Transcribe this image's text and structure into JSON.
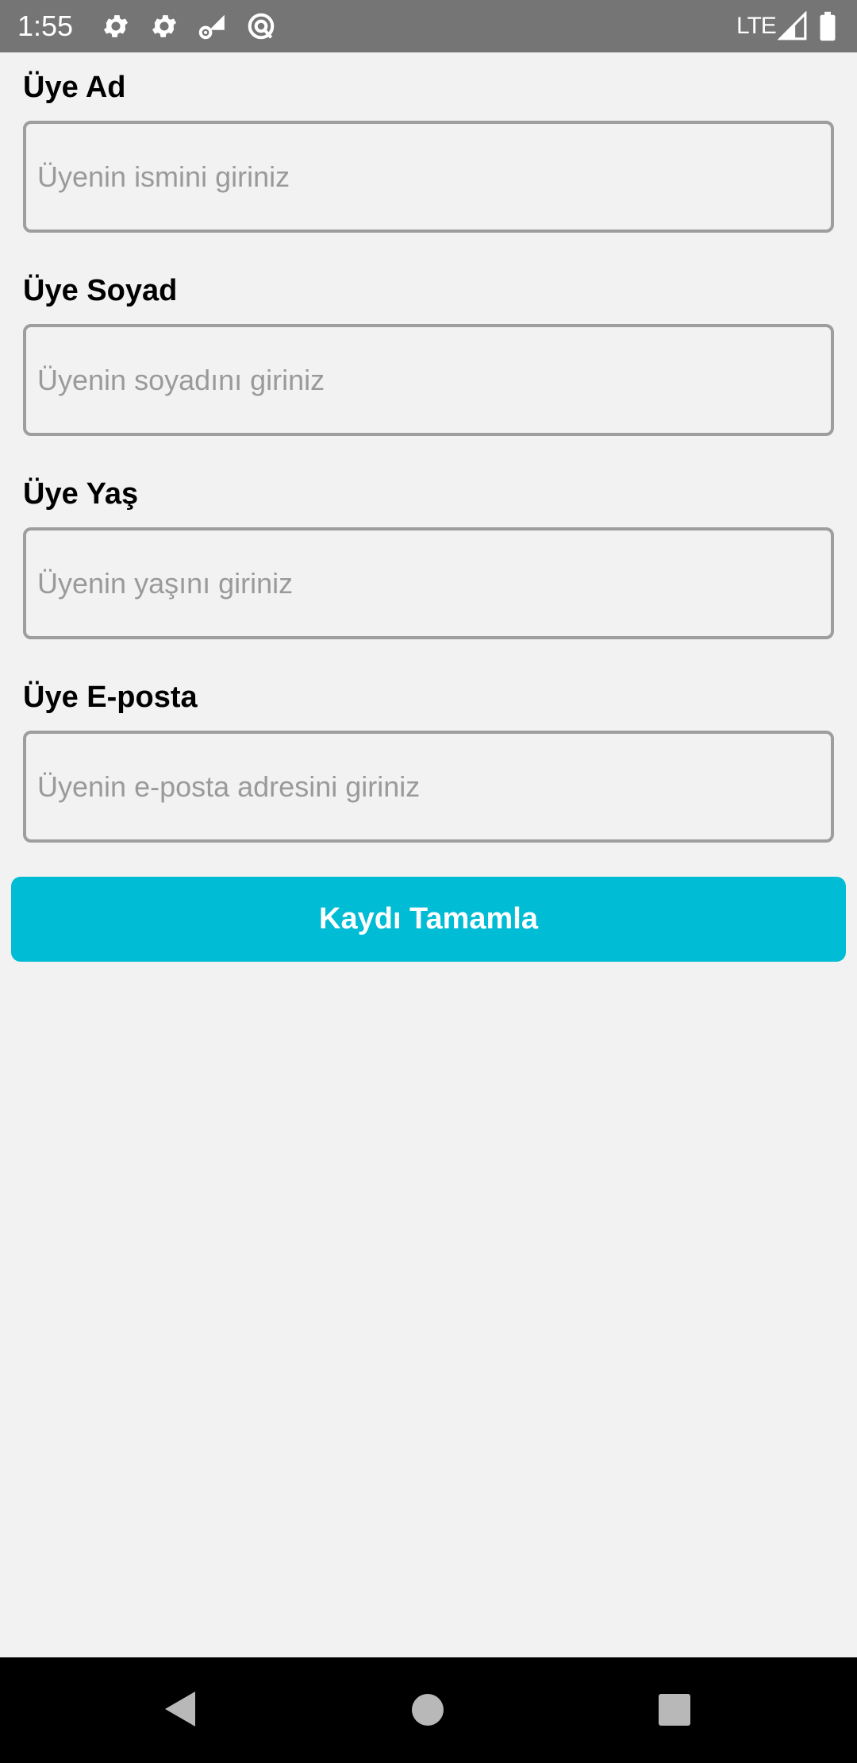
{
  "status_bar": {
    "time": "1:55",
    "network": "LTE",
    "icons": [
      "settings-icon",
      "settings-icon",
      "network-settings-icon",
      "data-saver-icon",
      "signal-icon",
      "battery-icon"
    ]
  },
  "form": {
    "fields": [
      {
        "label": "Üye Ad",
        "placeholder": "Üyenin ismini giriniz",
        "value": ""
      },
      {
        "label": "Üye Soyad",
        "placeholder": "Üyenin soyadını giriniz",
        "value": ""
      },
      {
        "label": "Üye Yaş",
        "placeholder": "Üyenin yaşını giriniz",
        "value": ""
      },
      {
        "label": "Üye E-posta",
        "placeholder": "Üyenin e-posta adresini giriniz",
        "value": ""
      }
    ],
    "submit_label": "Kaydı Tamamla"
  },
  "nav_bar": {
    "buttons": [
      "back-icon",
      "home-icon",
      "recents-icon"
    ]
  },
  "colors": {
    "accent": "#00bcd4",
    "status_bar": "#757575",
    "background": "#f2f2f2",
    "input_border": "#9e9e9e",
    "placeholder": "#9a9a9a"
  }
}
